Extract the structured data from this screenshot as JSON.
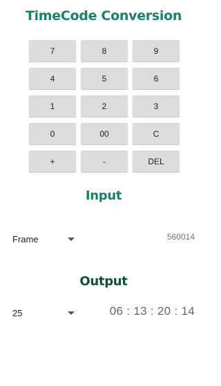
{
  "app": {
    "title": "TimeCode Conversion"
  },
  "keypad": {
    "keys": [
      "7",
      "8",
      "9",
      "4",
      "5",
      "6",
      "1",
      "2",
      "3",
      "0",
      "00",
      "C",
      "+",
      "-",
      "DEL"
    ]
  },
  "input": {
    "heading": "Input",
    "unit_selected": "Frame",
    "value": "560014"
  },
  "output": {
    "heading": "Output",
    "fps_selected": "25",
    "timecode": "06 : 13 : 20 : 14"
  },
  "colors": {
    "title": "#1b7f6a",
    "input_heading": "#1b7f6a",
    "output_heading": "#0d4f3c",
    "key_background": "#dcdcdc"
  },
  "icons": {
    "dropdown": "chevron-down-icon"
  }
}
